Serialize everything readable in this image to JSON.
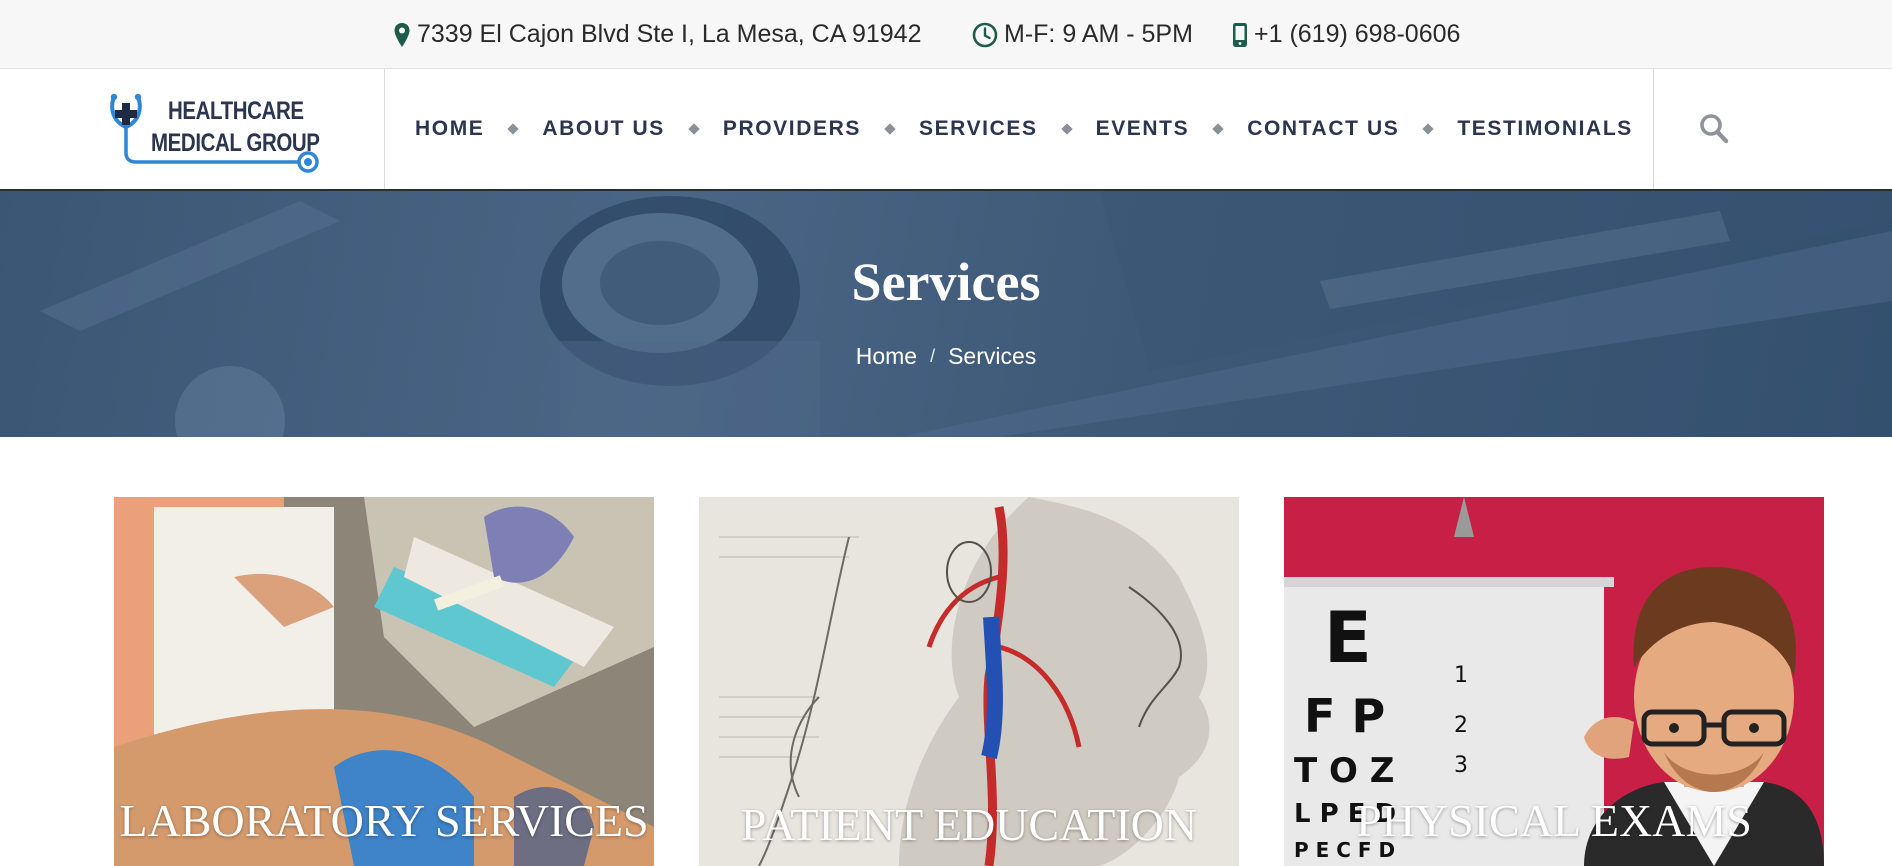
{
  "topbar": {
    "address": "7339 El Cajon Blvd Ste I, La Mesa, CA 91942",
    "hours": "M-F: 9 AM - 5PM",
    "phone": "+1 (619) 698-0606",
    "icons": [
      "map-pin-icon",
      "clock-icon",
      "mobile-phone-icon"
    ],
    "icon_color": "#1e5c4a"
  },
  "header": {
    "logo": {
      "line1": "HEALTHCARE",
      "line2": "MEDICAL GROUP",
      "accent_color": "#2f86d6",
      "text_color": "#2c3550"
    },
    "nav": [
      "HOME",
      "ABOUT US",
      "PROVIDERS",
      "SERVICES",
      "EVENTS",
      "CONTACT US",
      "TESTIMONIALS"
    ],
    "search_icon": "search-icon"
  },
  "hero": {
    "title": "Services",
    "breadcrumb": {
      "home": "Home",
      "separator": "/",
      "current": "Services"
    },
    "overlay_color": "#3e5878"
  },
  "cards": [
    {
      "title": "LABORATORY SERVICES",
      "image": "blood-draw-photo"
    },
    {
      "title": "PATIENT EDUCATION",
      "image": "anatomy-illustration"
    },
    {
      "title": "PHYSICAL EXAMS",
      "image": "eye-chart-doctor-illustration",
      "background": "#c81f47"
    }
  ]
}
